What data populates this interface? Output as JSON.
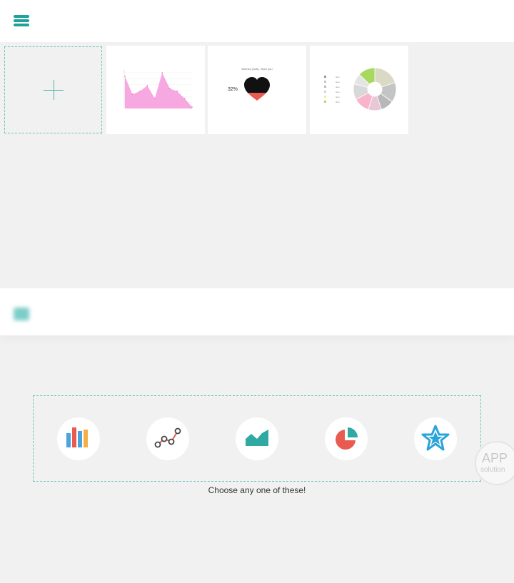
{
  "header": {
    "menu_icon": "hamburger-menu-icon",
    "accent": "#1ea39b"
  },
  "cards": {
    "add": {
      "icon": "plus-icon"
    },
    "area_chart": {
      "type": "area",
      "color": "#f7a8e0"
    },
    "heart_chart": {
      "type": "heart",
      "percent_label": "32%",
      "title": "Women (self) - Sure you"
    },
    "donut_chart": {
      "type": "pie",
      "legend": [
        "Item",
        "Item",
        "Item",
        "Item",
        "Item",
        "Item"
      ],
      "slices": [
        {
          "value": 20,
          "color": "#dadac4"
        },
        {
          "value": 15,
          "color": "#c4c4c4"
        },
        {
          "value": 10,
          "color": "#b8b8b8"
        },
        {
          "value": 10,
          "color": "#e8c8d4"
        },
        {
          "value": 12,
          "color": "#f8b4cc"
        },
        {
          "value": 12,
          "color": "#d8d8d8"
        },
        {
          "value": 8,
          "color": "#e4e4e4"
        },
        {
          "value": 13,
          "color": "#a8d860"
        }
      ]
    }
  },
  "picker": {
    "types": [
      {
        "name": "bar-chart-type-button",
        "icon": "bar-chart-icon"
      },
      {
        "name": "line-chart-type-button",
        "icon": "line-chart-icon"
      },
      {
        "name": "area-chart-type-button",
        "icon": "area-chart-icon"
      },
      {
        "name": "pie-chart-type-button",
        "icon": "pie-chart-icon"
      },
      {
        "name": "star-chart-type-button",
        "icon": "star-icon"
      }
    ],
    "hint": "Choose any one of these!"
  },
  "badge": {
    "top": "APP",
    "bottom": "solution"
  },
  "chart_data": {
    "type": "area",
    "x": [
      0,
      1,
      2,
      3,
      4,
      5,
      6,
      7,
      8,
      9
    ],
    "values": [
      45,
      20,
      24,
      32,
      14,
      50,
      28,
      24,
      14,
      2
    ],
    "title": "",
    "xlabel": "",
    "ylabel": ""
  }
}
